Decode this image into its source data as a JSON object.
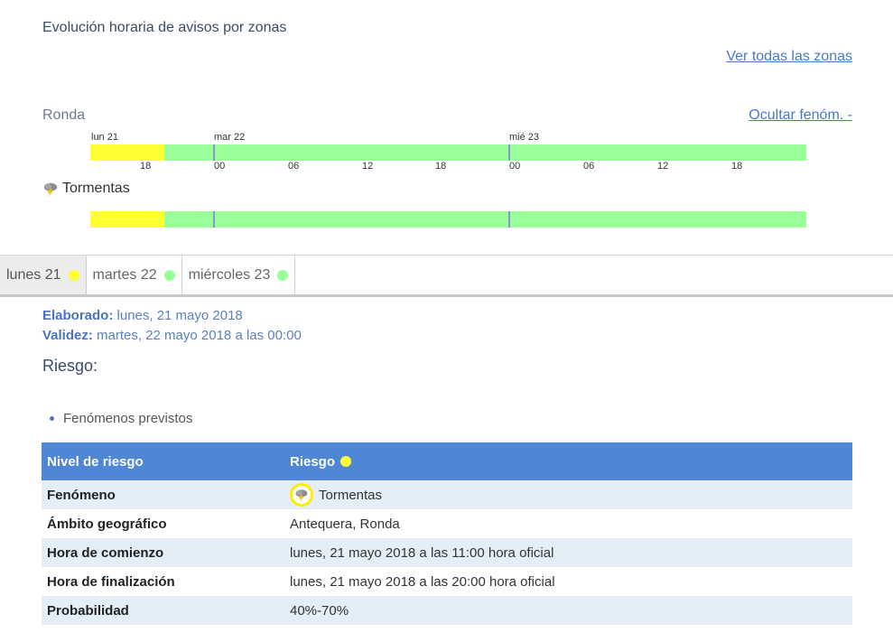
{
  "header": {
    "title": "Evolución horaria de avisos por zonas",
    "all_zones_link": "Ver todas las zonas"
  },
  "zone": {
    "name": "Ronda",
    "hide_link": "Ocultar fenóm. -"
  },
  "timeline": {
    "days": [
      "lun 21",
      "mar 22",
      "mié 23"
    ],
    "hours": [
      "18",
      "00",
      "06",
      "12",
      "18",
      "00",
      "06",
      "12",
      "18"
    ],
    "phenomenon": "Tormentas",
    "colors": {
      "yellow": "#ffff33",
      "green": "#99ff99",
      "divider": "#8a95d6"
    }
  },
  "tabs": [
    {
      "label": "lunes 21",
      "color": "#ffff33",
      "active": true
    },
    {
      "label": "martes 22",
      "color": "#99ff99",
      "active": false
    },
    {
      "label": "miércoles 23",
      "color": "#99ff99",
      "active": false
    }
  ],
  "details": {
    "elaborado_label": "Elaborado:",
    "elaborado_value": "lunes, 21 mayo 2018",
    "validez_label": "Validez:",
    "validez_value": "martes, 22 mayo 2018 a las 00:00",
    "riesgo_heading": "Riesgo:",
    "bullet": "Fenómenos previstos"
  },
  "table": {
    "header_left": "Nivel de riesgo",
    "header_right": "Riesgo",
    "header_dot_color": "#ffff33",
    "rows": [
      {
        "key": "Fenómeno",
        "value": "Tormentas",
        "icon": "storm-icon"
      },
      {
        "key": "Ámbito geográfico",
        "value": "Antequera, Ronda"
      },
      {
        "key": "Hora de comienzo",
        "value": "lunes, 21 mayo 2018 a las 11:00 hora oficial"
      },
      {
        "key": "Hora de finalización",
        "value": "lunes, 21 mayo 2018 a las 20:00 hora oficial"
      },
      {
        "key": "Probabilidad",
        "value": "40%-70%"
      }
    ]
  }
}
